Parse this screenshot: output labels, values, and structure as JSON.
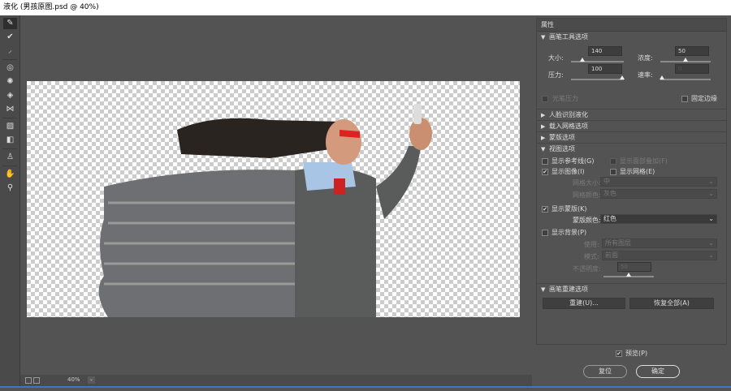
{
  "title": "液化 (男孩原图.psd @ 40%)",
  "tools": [
    "forward-warp",
    "reconstruct",
    "smooth",
    "twirl-clockwise",
    "pucker",
    "bloat",
    "push-left",
    "freeze-mask",
    "thaw-mask",
    "face",
    "hand",
    "zoom"
  ],
  "status": {
    "zoom": "40%"
  },
  "panel": {
    "header": "属性",
    "brush": {
      "title": "画笔工具选项",
      "size_label": "大小:",
      "size": "140",
      "size_pct": 22,
      "density_label": "浓度:",
      "density": "50",
      "density_pct": 50,
      "pressure_label": "压力:",
      "pressure": "100",
      "pressure_pct": 100,
      "rate_label": "速率:",
      "rate": "0",
      "rate_pct": 0,
      "stylus": "光笔压力",
      "pin_edges": "固定边缘"
    },
    "face": "人脸识别液化",
    "mesh": "载入网格选项",
    "mask": "蒙版选项",
    "view": {
      "title": "视图选项",
      "guides": "显示参考线(G)",
      "face_overlay": "显示面部叠加(F)",
      "image": "显示图像(I)",
      "mesh": "显示网格(E)",
      "mesh_size_label": "网格大小:",
      "mesh_size": "中",
      "mesh_color_label": "网格颜色:",
      "mesh_color": "灰色",
      "show_mask": "显示蒙版(K)",
      "mask_color_label": "蒙版颜色:",
      "mask_color": "红色",
      "backdrop": "显示背景(P)",
      "use_label": "使用:",
      "use": "所有图层",
      "mode_label": "模式:",
      "mode": "前面",
      "opacity_label": "不透明度:",
      "opacity": "50",
      "opacity_pct": 50
    },
    "rebuild": {
      "title": "画笔重建选项",
      "reconstruct": "重建(U)...",
      "restore": "恢复全部(A)"
    }
  },
  "footer": {
    "preview": "预览(P)",
    "reset": "复位",
    "ok": "确定"
  }
}
